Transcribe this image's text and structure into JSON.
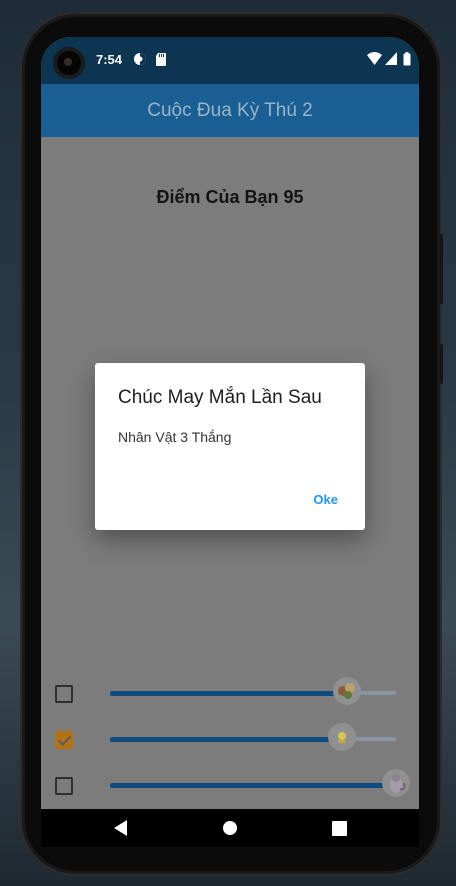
{
  "status_bar": {
    "time": "7:54",
    "left_icons": [
      "sync-icon",
      "sd-card-icon"
    ],
    "right_icons": [
      "wifi-icon",
      "signal-icon",
      "battery-icon"
    ]
  },
  "app_bar": {
    "title": "Cuộc Đua Kỳ Thú 2"
  },
  "score_label": "Điểm Của Bạn 95",
  "racers": [
    {
      "checked": false,
      "progress": 0.83,
      "avatar": "racer-1-icon"
    },
    {
      "checked": true,
      "progress": 0.81,
      "avatar": "racer-2-icon"
    },
    {
      "checked": false,
      "progress": 1.0,
      "avatar": "racer-3-icon"
    }
  ],
  "dialog": {
    "title": "Chúc May Mắn Lần Sau",
    "message": "Nhân Vật 3 Thắng",
    "ok_label": "Oke"
  },
  "nav_bar": {
    "buttons": [
      "back-icon",
      "home-icon",
      "recents-icon"
    ]
  },
  "colors": {
    "app_bar": "#1a5f93",
    "status_bar": "#0c3552",
    "slider_fill": "#0f4c7d",
    "accent": "#2196f3",
    "checkbox_checked": "#b37213"
  }
}
